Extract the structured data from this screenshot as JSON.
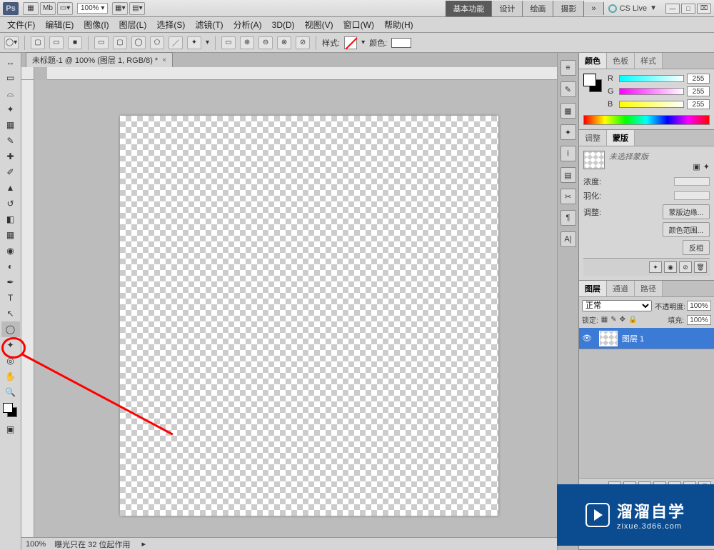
{
  "header": {
    "logo": "Ps",
    "zoom_display": "100%",
    "workspace_tabs": [
      "基本功能",
      "设计",
      "绘画",
      "摄影"
    ],
    "more_label": "»",
    "cslive": "CS Live",
    "dropdown_arrow": "▼"
  },
  "menu": [
    "文件(F)",
    "编辑(E)",
    "图像(I)",
    "图层(L)",
    "选择(S)",
    "滤镜(T)",
    "分析(A)",
    "3D(D)",
    "视图(V)",
    "窗口(W)",
    "帮助(H)"
  ],
  "options": {
    "style_label": "样式:",
    "color_label": "颜色:"
  },
  "document": {
    "tab_title": "未标题-1 @ 100% (图层 1, RGB/8) *",
    "status_zoom": "100%",
    "status_text": "曝光只在 32 位起作用"
  },
  "panels": {
    "color": {
      "tabs": [
        "颜色",
        "色板",
        "样式"
      ],
      "channels": [
        {
          "label": "R",
          "value": "255"
        },
        {
          "label": "G",
          "value": "255"
        },
        {
          "label": "B",
          "value": "255"
        }
      ]
    },
    "mask": {
      "tabs": [
        "调整",
        "蒙版"
      ],
      "none_text": "未选择蒙版",
      "density_label": "浓度:",
      "feather_label": "羽化:",
      "adjust_label": "调整:",
      "btn_edge": "蒙版边缘...",
      "btn_range": "颜色范围...",
      "btn_invert": "反相"
    },
    "layers": {
      "tabs": [
        "图层",
        "通道",
        "路径"
      ],
      "blend_mode": "正常",
      "opacity_label": "不透明度:",
      "opacity_value": "100%",
      "lock_label": "锁定:",
      "fill_label": "填充:",
      "fill_value": "100%",
      "layer_name": "图层 1"
    }
  },
  "watermark": {
    "title": "溜溜自学",
    "url": "zixue.3d66.com"
  }
}
